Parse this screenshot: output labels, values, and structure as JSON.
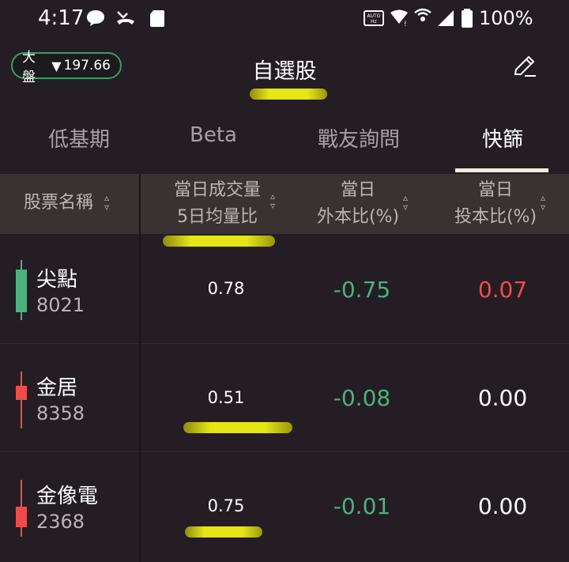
{
  "status_bar": {
    "time": "4:17",
    "battery": "100%",
    "icons": [
      "chat-bubble-icon",
      "missed-call-icon",
      "sd-card-icon",
      "auto-hz-icon",
      "wifi-icon",
      "hotspot-icon",
      "signal-icon",
      "battery-icon"
    ]
  },
  "header": {
    "market_label": "大盤",
    "market_arrow": "▼",
    "market_value": "197.66",
    "title": "自選股",
    "edit_icon": "pencil-icon"
  },
  "tabs": [
    {
      "label": "低基期",
      "active": false
    },
    {
      "label": "Beta",
      "active": false
    },
    {
      "label": "戰友詢問",
      "active": false
    },
    {
      "label": "快篩",
      "active": true
    }
  ],
  "table": {
    "headers": {
      "name": "股票名稱",
      "col1_line1": "當日成交量",
      "col1_line2": "5日均量比",
      "col2_line1": "當日",
      "col2_line2": "外本比(%)",
      "col3_line1": "當日",
      "col3_line2": "投本比(%)"
    },
    "rows": [
      {
        "name": "尖點",
        "code": "8021",
        "vol_ratio": "0.78",
        "foreign_ratio": "-0.75",
        "trust_ratio": "0.07",
        "candle": "green"
      },
      {
        "name": "金居",
        "code": "8358",
        "vol_ratio": "0.51",
        "foreign_ratio": "-0.08",
        "trust_ratio": "0.00",
        "candle": "red"
      },
      {
        "name": "金像電",
        "code": "2368",
        "vol_ratio": "0.75",
        "foreign_ratio": "-0.01",
        "trust_ratio": "0.00",
        "candle": "red"
      }
    ]
  },
  "colors": {
    "background": "#241d24",
    "header_bg": "#3a3133",
    "positive": "#ef4b4b",
    "negative": "#4cb17f",
    "badge_border": "#3c9a6a",
    "highlight": "#f0f014"
  }
}
